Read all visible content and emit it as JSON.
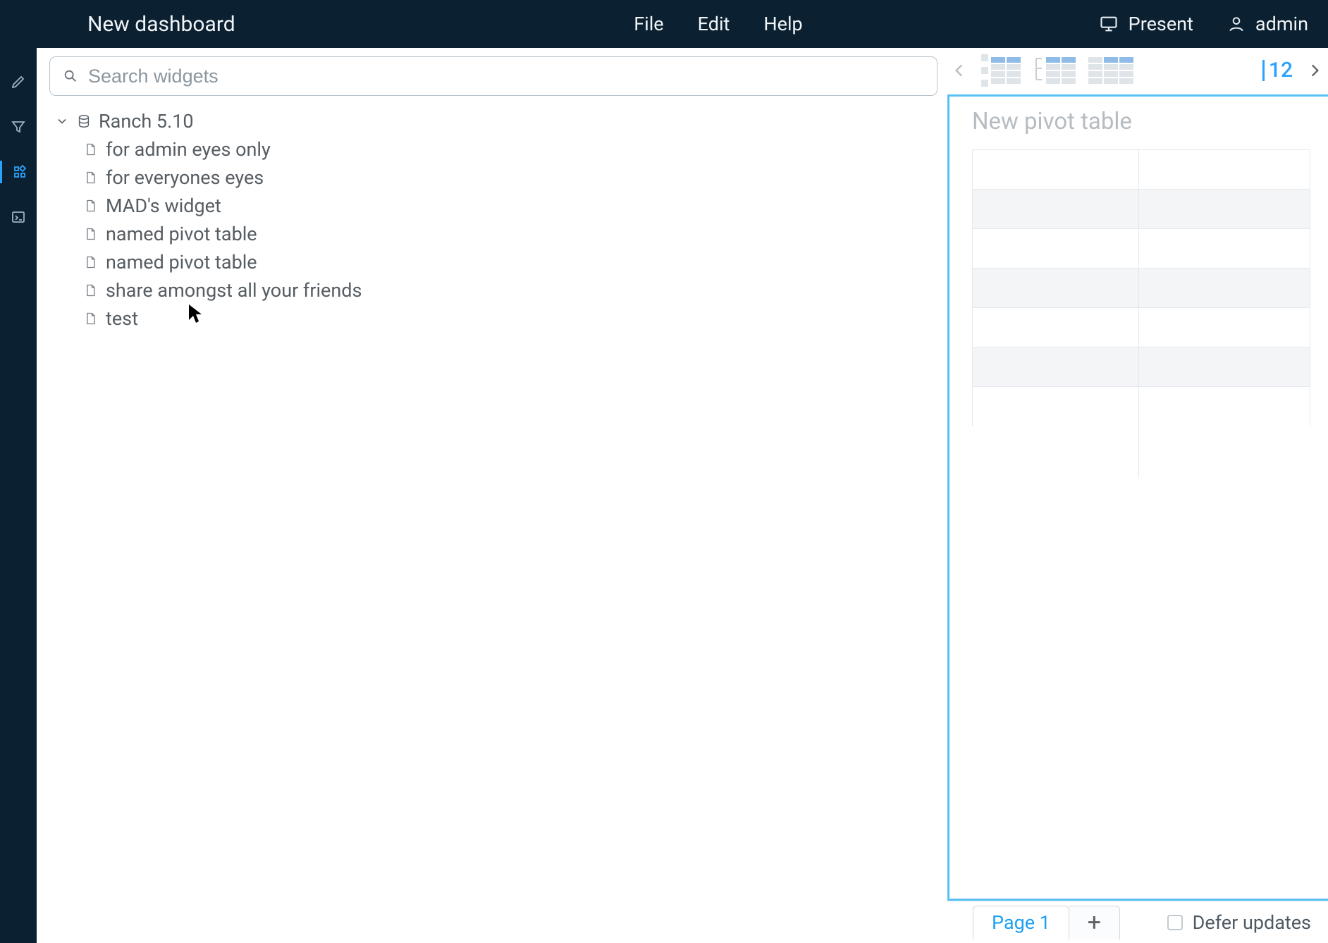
{
  "header": {
    "title": "New dashboard",
    "menu": {
      "file": "File",
      "edit": "Edit",
      "help": "Help"
    },
    "present": "Present",
    "user": "admin"
  },
  "rail": {
    "items": [
      {
        "name": "edit-tool-icon"
      },
      {
        "name": "filter-tool-icon"
      },
      {
        "name": "widgets-tool-icon"
      },
      {
        "name": "console-tool-icon"
      }
    ],
    "active_index": 2
  },
  "search": {
    "placeholder": "Search widgets"
  },
  "tree": {
    "root_label": "Ranch 5.10",
    "items": [
      "for admin eyes only",
      "for everyones eyes",
      "MAD's widget",
      "named pivot table",
      "named pivot table",
      "share amongst all your friends",
      "test"
    ]
  },
  "toolbar": {
    "row_count": "12"
  },
  "widget": {
    "title": "New pivot table"
  },
  "footer": {
    "pages": [
      "Page 1"
    ],
    "add_label": "+",
    "defer_label": "Defer updates",
    "defer_checked": false
  }
}
